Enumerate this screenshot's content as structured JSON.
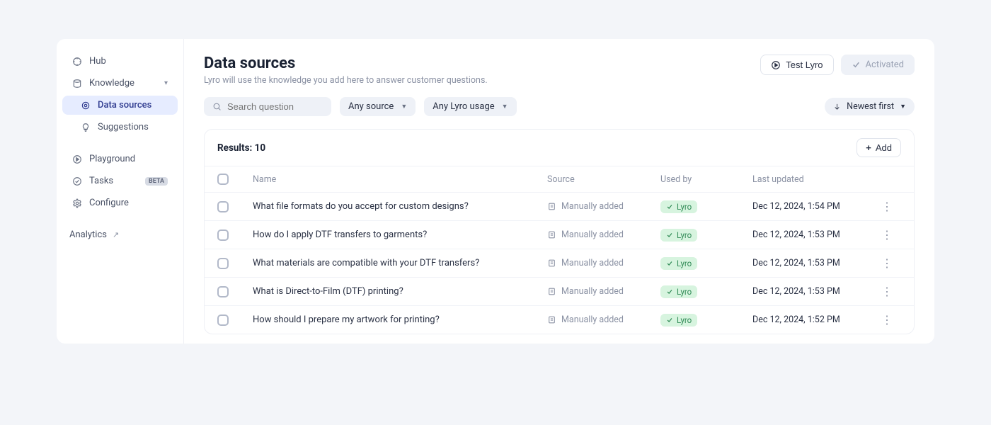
{
  "sidebar": {
    "hub": "Hub",
    "knowledge": "Knowledge",
    "data_sources": "Data sources",
    "suggestions": "Suggestions",
    "playground": "Playground",
    "tasks": "Tasks",
    "tasks_badge": "BETA",
    "configure": "Configure",
    "analytics": "Analytics"
  },
  "header": {
    "title": "Data sources",
    "subtitle": "Lyro will use the knowledge you add here to answer customer questions.",
    "test_label": "Test Lyro",
    "activated_label": "Activated"
  },
  "filters": {
    "search_placeholder": "Search question",
    "source": "Any source",
    "usage": "Any Lyro usage",
    "sort": "Newest first"
  },
  "results": {
    "label": "Results: 10",
    "add_label": "Add",
    "columns": {
      "name": "Name",
      "source": "Source",
      "used_by": "Used by",
      "updated": "Last updated"
    },
    "source_text": "Manually added",
    "tag_text": "Lyro",
    "rows": [
      {
        "name": "What file formats do you accept for custom designs?",
        "updated": "Dec 12, 2024, 1:54 PM"
      },
      {
        "name": "How do I apply DTF transfers to garments?",
        "updated": "Dec 12, 2024, 1:53 PM"
      },
      {
        "name": "What materials are compatible with your DTF transfers?",
        "updated": "Dec 12, 2024, 1:53 PM"
      },
      {
        "name": "What is Direct-to-Film (DTF) printing?",
        "updated": "Dec 12, 2024, 1:53 PM"
      },
      {
        "name": "How should I prepare my artwork for printing?",
        "updated": "Dec 12, 2024, 1:52 PM"
      }
    ]
  }
}
